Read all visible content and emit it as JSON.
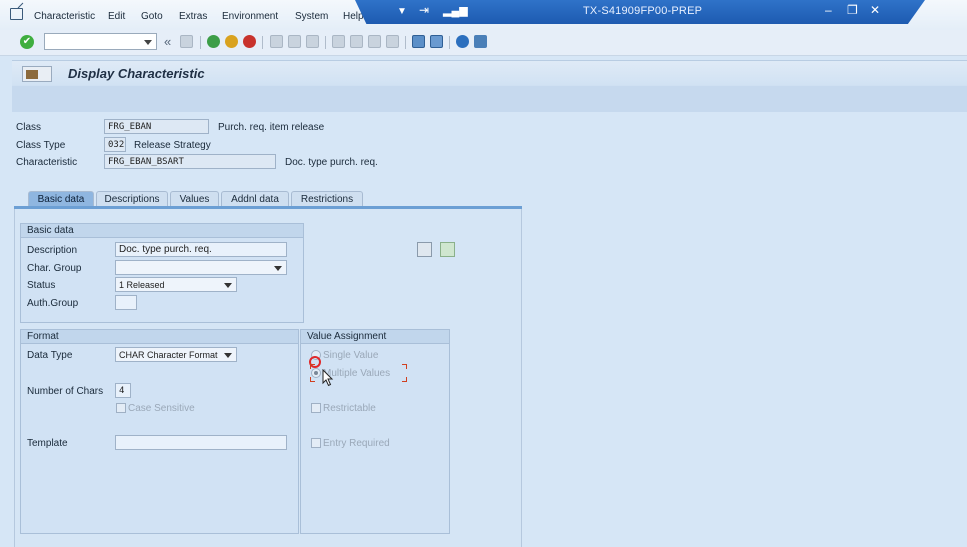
{
  "menu": {
    "items": [
      "Characteristic",
      "Edit",
      "Goto",
      "Extras",
      "Environment",
      "System",
      "Help"
    ]
  },
  "window": {
    "system_title": "TX-S41909FP00-PREP"
  },
  "toolbar": {
    "command_field_value": "",
    "back_glyph": "«"
  },
  "header": {
    "title": "Display Characteristic"
  },
  "header_fields": {
    "class_label": "Class",
    "class_value": "FRG_EBAN",
    "class_desc": "Purch. req. item release",
    "class_type_label": "Class Type",
    "class_type_value": "032",
    "class_type_desc": "Release Strategy",
    "characteristic_label": "Characteristic",
    "characteristic_value": "FRG_EBAN_BSART",
    "characteristic_desc": "Doc. type purch. req."
  },
  "tabs": [
    "Basic data",
    "Descriptions",
    "Values",
    "Addnl data",
    "Restrictions"
  ],
  "basic_data": {
    "group_title": "Basic data",
    "description_label": "Description",
    "description_value": "Doc. type purch. req.",
    "char_group_label": "Char. Group",
    "char_group_value": "",
    "status_label": "Status",
    "status_value": "1 Released",
    "auth_group_label": "Auth.Group",
    "auth_group_value": ""
  },
  "format": {
    "group_title": "Format",
    "data_type_label": "Data Type",
    "data_type_value": "CHAR Character Format",
    "num_chars_label": "Number of Chars",
    "num_chars_value": "4",
    "case_sensitive_label": "Case Sensitive",
    "template_label": "Template",
    "template_value": ""
  },
  "value_assignment": {
    "group_title": "Value Assignment",
    "single_value_label": "Single Value",
    "multiple_values_label": "Multiple Values",
    "selected": "Multiple Values",
    "restrictable_label": "Restrictable",
    "entry_required_label": "Entry Required"
  },
  "colors": {
    "title_band": "#1d5bb0",
    "background": "#d6e6f6",
    "active_tab": "#8fb6e0",
    "highlight": "#e0282a"
  }
}
